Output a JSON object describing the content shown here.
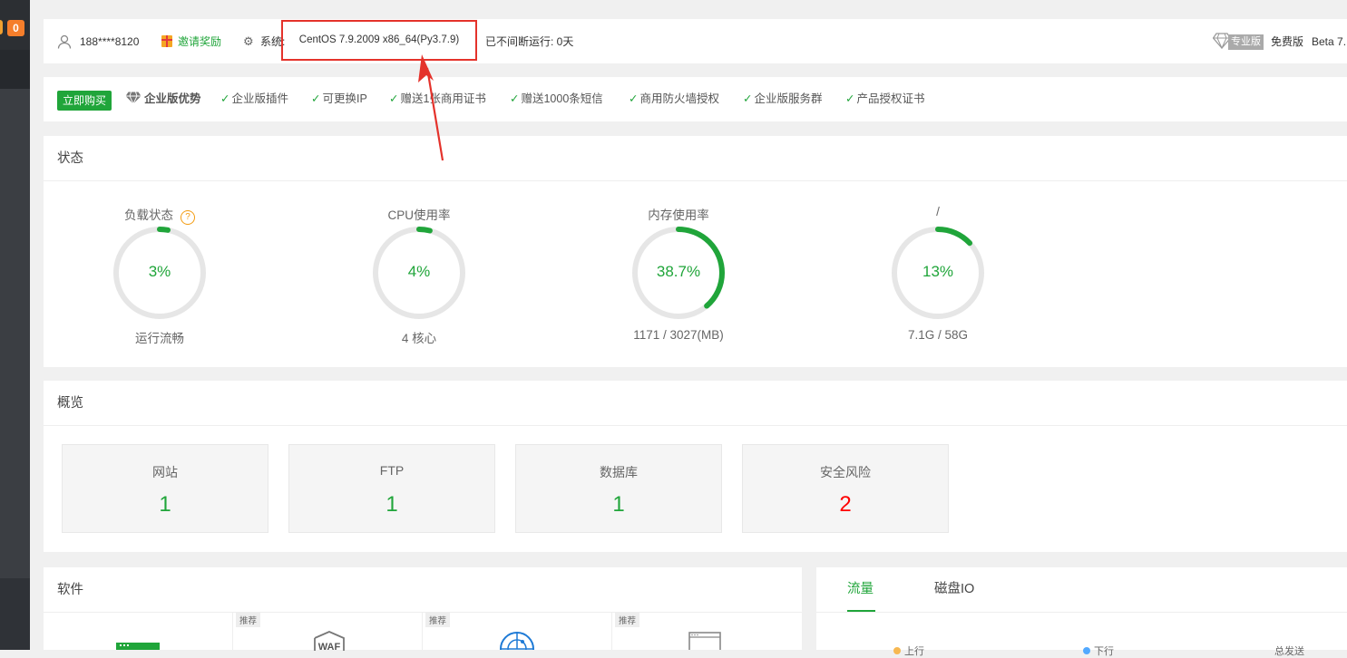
{
  "sidebar": {
    "badge": "0"
  },
  "topbar": {
    "phone": "188****8120",
    "invite": "邀请奖励",
    "system_label": "系统:",
    "system_info": "CentOS 7.9.2009 x86_64(Py3.7.9)",
    "uptime": "已不间断运行: 0天",
    "pro_badge": "专业版",
    "free": "免费版",
    "beta": "Beta 7."
  },
  "enterprise": {
    "buy_label": "立即购买",
    "advantage": "企业版优势",
    "features": [
      "企业版插件",
      "可更换IP",
      "赠送1张商用证书",
      "赠送1000条短信",
      "商用防火墙授权",
      "企业版服务群",
      "产品授权证书"
    ]
  },
  "status": {
    "title": "状态",
    "gauges": [
      {
        "label": "负载状态",
        "value": "3%",
        "percent": 3,
        "sub": "运行流畅"
      },
      {
        "label": "CPU使用率",
        "value": "4%",
        "percent": 4,
        "sub": "4 核心"
      },
      {
        "label": "内存使用率",
        "value": "38.7%",
        "percent": 38.7,
        "sub": "1171 / 3027(MB)"
      },
      {
        "label": "/",
        "value": "13%",
        "percent": 13,
        "sub": "7.1G / 58G"
      }
    ]
  },
  "overview": {
    "title": "概览",
    "items": [
      {
        "name": "网站",
        "value": "1"
      },
      {
        "name": "FTP",
        "value": "1"
      },
      {
        "name": "数据库",
        "value": "1"
      },
      {
        "name": "安全风险",
        "value": "2"
      }
    ]
  },
  "software": {
    "title": "软件",
    "tags": [
      "推荐",
      "推荐",
      "推荐"
    ],
    "waf_text": "WAF"
  },
  "traffic": {
    "tabs": [
      "流量",
      "磁盘IO"
    ],
    "legend": [
      "上行",
      "下行",
      "总发送"
    ]
  },
  "colors": {
    "accent": "#20a53a",
    "danger": "#ff0000",
    "annotation": "#e4322b"
  }
}
